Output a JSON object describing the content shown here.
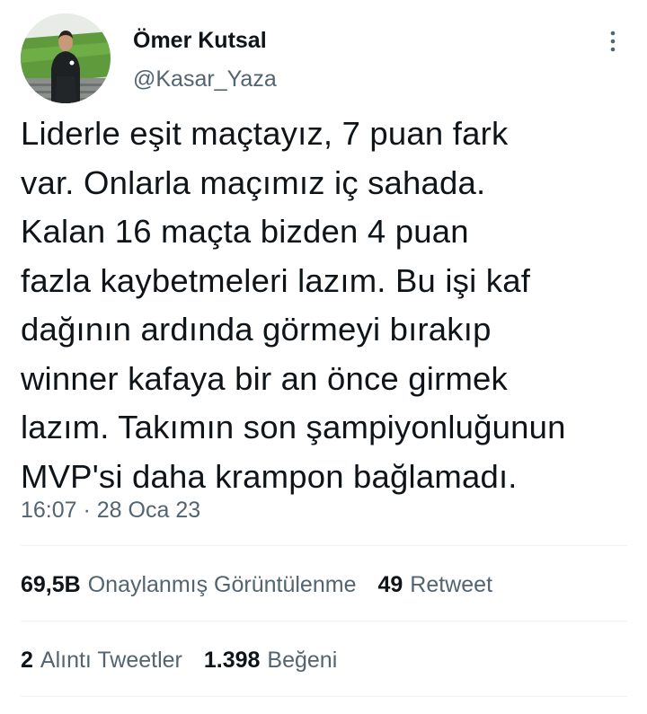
{
  "author": {
    "name": "Ömer Kutsal",
    "handle": "@Kasar_Yaza"
  },
  "tweet": {
    "text": "Liderle eşit maçtayız, 7 puan fark\nvar. Onlarla maçımız iç sahada.\nKalan 16 maçta bizden 4 puan\nfazla kaybetmeleri lazım. Bu işi kaf\ndağının ardında görmeyi bırakıp\nwinner kafaya bir an önce girmek\nlazım. Takımın son şampiyonluğunun\nMVP'si daha krampon bağlamadı.",
    "timestamp": "16:07 · 28 Oca 23"
  },
  "stats": {
    "views_value": "69,5B",
    "views_label": "Onaylanmış Görüntülenme",
    "retweets_value": "49",
    "retweets_label": "Retweet",
    "quotes_value": "2",
    "quotes_label": "Alıntı Tweetler",
    "likes_value": "1.398",
    "likes_label": "Beğeni"
  },
  "icons": {
    "more": "more-vertical-icon"
  },
  "colors": {
    "primary_text": "#0f1419",
    "secondary_text": "#536471",
    "divider": "#eff3f4",
    "background": "#ffffff"
  }
}
